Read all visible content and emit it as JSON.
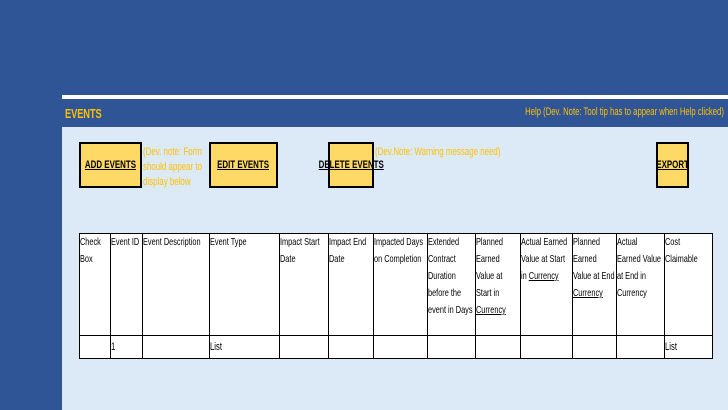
{
  "header": {
    "title": "EVENTS",
    "help_text": "Help (Dev. Note: Tool tip has to appear when Help clicked)"
  },
  "toolbar": {
    "add_label": "ADD EVENTS",
    "add_note": "(Dev. note: Form should appear to display below",
    "edit_label": "EDIT EVENTS",
    "delete_label": "DELETE EVENTS",
    "delete_note": "(Dev.Note: Warning message need)",
    "export_label": "EXPORT"
  },
  "table": {
    "columns": [
      "Check Box",
      "Event ID",
      "Event Description",
      "Event Type",
      "Impact Start Date",
      "Impact End Date",
      "Impacted Days on Completion",
      "Extended Contract Duration before the event in Days",
      "Planned Earned Value at Start in |Currency|",
      "Actual Earned Value at Start in |Currency|",
      "Planned Earned Value at End |Currency|",
      "Actual Earned Value at End in Currency",
      "Cost Claimable"
    ],
    "rows": [
      [
        "",
        "1",
        "",
        "List",
        "",
        "",
        "",
        "",
        "",
        "",
        "",
        "",
        "List"
      ]
    ]
  },
  "colors": {
    "background": "#2f5597",
    "accent_text": "#ffc000",
    "button_fill": "#ffd966",
    "content_fill": "#dce9f6"
  }
}
